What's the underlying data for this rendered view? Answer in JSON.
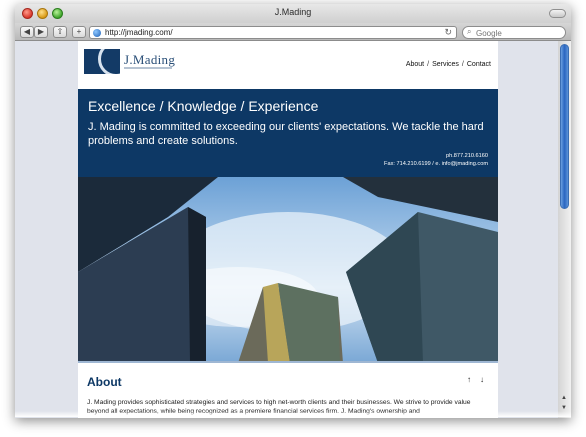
{
  "window": {
    "title": "J.Mading"
  },
  "toolbar": {
    "back": "◀",
    "forward": "▶",
    "share": "⇧",
    "add": "+",
    "url": "http://jmading.com/",
    "reload": "↻",
    "search_placeholder": "Google"
  },
  "site": {
    "logo_text": "J.Mading",
    "nav": [
      "About",
      "Services",
      "Contact"
    ],
    "nav_sep": "/",
    "banner_title": "Excellence / Knowledge / Experience",
    "banner_body": "J. Mading is committed to exceeding our clients' expectations. We tackle the hard problems and create solutions.",
    "phone": "ph.877.210.6160",
    "fax_email": "Fax: 714.210.6199 / e. info@jmading.com",
    "about_title": "About",
    "about_up": "↑",
    "about_down": "↓",
    "about_text": "J. Mading provides sophisticated strategies and services to high net-worth clients and their businesses. We strive to provide value beyond all expectations, while being recognized as a premiere financial services firm. J. Mading's ownership and"
  },
  "colors": {
    "navy": "#0d3865",
    "accent": "#2a65c0"
  }
}
